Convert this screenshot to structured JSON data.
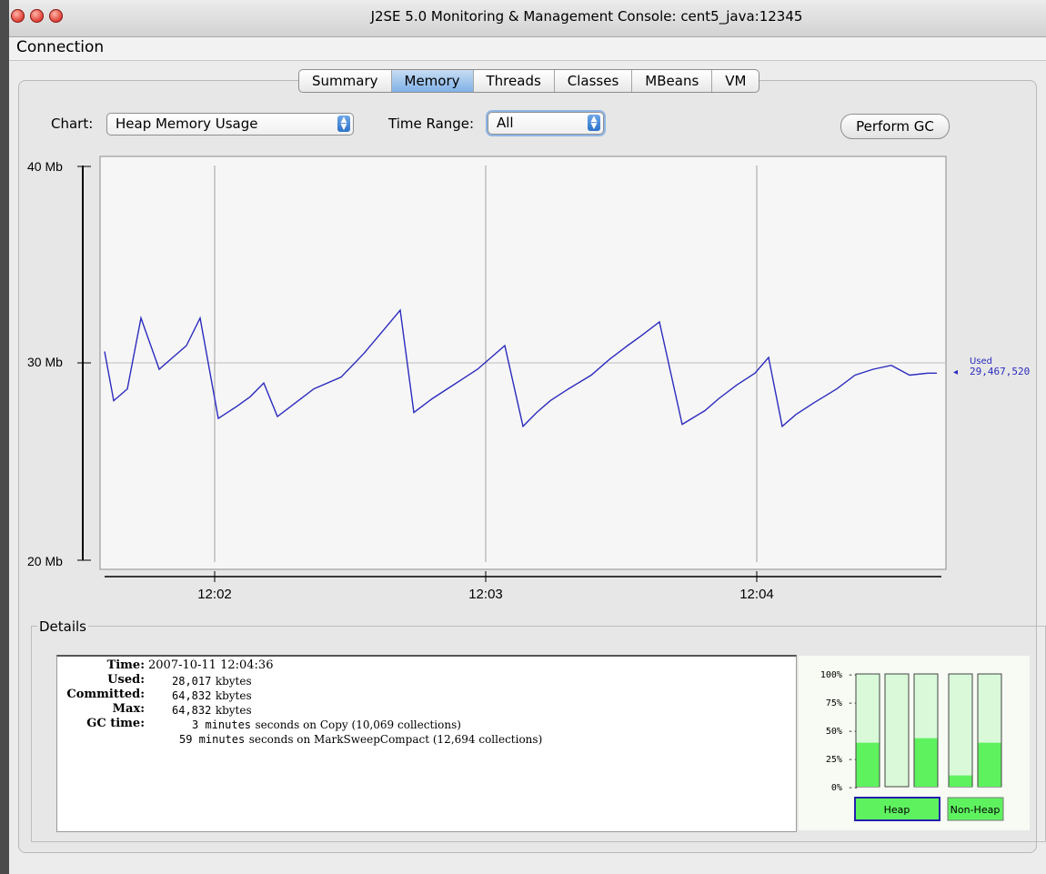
{
  "window": {
    "title": "J2SE 5.0 Monitoring & Management Console: cent5_java:12345"
  },
  "menubar": {
    "items": [
      {
        "label": "Connection"
      }
    ]
  },
  "tabs": [
    {
      "label": "Summary",
      "active": false
    },
    {
      "label": "Memory",
      "active": true
    },
    {
      "label": "Threads",
      "active": false
    },
    {
      "label": "Classes",
      "active": false
    },
    {
      "label": "MBeans",
      "active": false
    },
    {
      "label": "VM",
      "active": false
    }
  ],
  "controls": {
    "chart_label": "Chart:",
    "chart_value": "Heap Memory Usage",
    "time_range_label": "Time Range:",
    "time_range_value": "All",
    "perform_gc_label": "Perform GC"
  },
  "chart_data": {
    "type": "line",
    "title": "",
    "yticks": [
      "40 Mb",
      "30 Mb",
      "20 Mb"
    ],
    "ylim": [
      20,
      40
    ],
    "xticks": [
      "12:02",
      "12:03",
      "12:04"
    ],
    "series": [
      {
        "name": "Used",
        "color": "#2b2bbf",
        "x": [
          0,
          0.1,
          0.25,
          0.4,
          0.6,
          0.75,
          0.9,
          1.05,
          1.25,
          1.45,
          1.6,
          1.75,
          1.9,
          2.1,
          2.3,
          2.6,
          2.85,
          3.05,
          3.25,
          3.4,
          3.6,
          3.8,
          4.1,
          4.4,
          4.6,
          4.75,
          4.9,
          5.1,
          5.35,
          5.55,
          5.75,
          5.9,
          6.1,
          6.35,
          6.6,
          6.75,
          6.95,
          7.15,
          7.3,
          7.45,
          7.6,
          7.8,
          8.05,
          8.25,
          8.45,
          8.65,
          8.85,
          9.05,
          9.15
        ],
        "y": [
          30.6,
          28.1,
          28.7,
          32.3,
          29.7,
          30.3,
          30.9,
          32.3,
          27.2,
          27.8,
          28.3,
          29.0,
          27.3,
          28.0,
          28.7,
          29.3,
          30.5,
          31.6,
          32.7,
          27.5,
          28.2,
          28.8,
          29.7,
          30.9,
          26.8,
          27.5,
          28.1,
          28.7,
          29.4,
          30.2,
          30.9,
          31.4,
          32.1,
          26.9,
          27.6,
          28.2,
          28.9,
          29.5,
          30.3,
          26.8,
          27.4,
          28.0,
          28.7,
          29.4,
          29.7,
          29.9,
          29.4,
          29.5,
          29.5
        ],
        "current_label": "Used",
        "current_value": "29,467,520"
      }
    ]
  },
  "details": {
    "title": "Details",
    "time_label": "Time:",
    "time_value": "2007-10-11 12:04:36",
    "used_label": "Used:",
    "used_num": "28,017",
    "used_unit": "kbytes",
    "committed_label": "Committed:",
    "committed_num": "64,832",
    "committed_unit": "kbytes",
    "max_label": "Max:",
    "max_num": "64,832",
    "max_unit": "kbytes",
    "gc_label": "GC time:",
    "gc1_num": "3 minutes",
    "gc1_text": "seconds on Copy (10,069 collections)",
    "gc2_num": "59 minutes",
    "gc2_text": "seconds on MarkSweepCompact (12,694 collections)"
  },
  "memory_bars": {
    "ticks": [
      "100% --",
      "75% --",
      "50% --",
      "25% --",
      "0% --"
    ],
    "heap_label": "Heap",
    "nonheap_label": "Non-Heap",
    "heap": [
      0.39,
      0.0,
      0.43
    ],
    "nonheap": [
      0.1,
      0.39
    ],
    "fill_color": "#5ff25f",
    "empty_color": "#d9f9d9"
  }
}
